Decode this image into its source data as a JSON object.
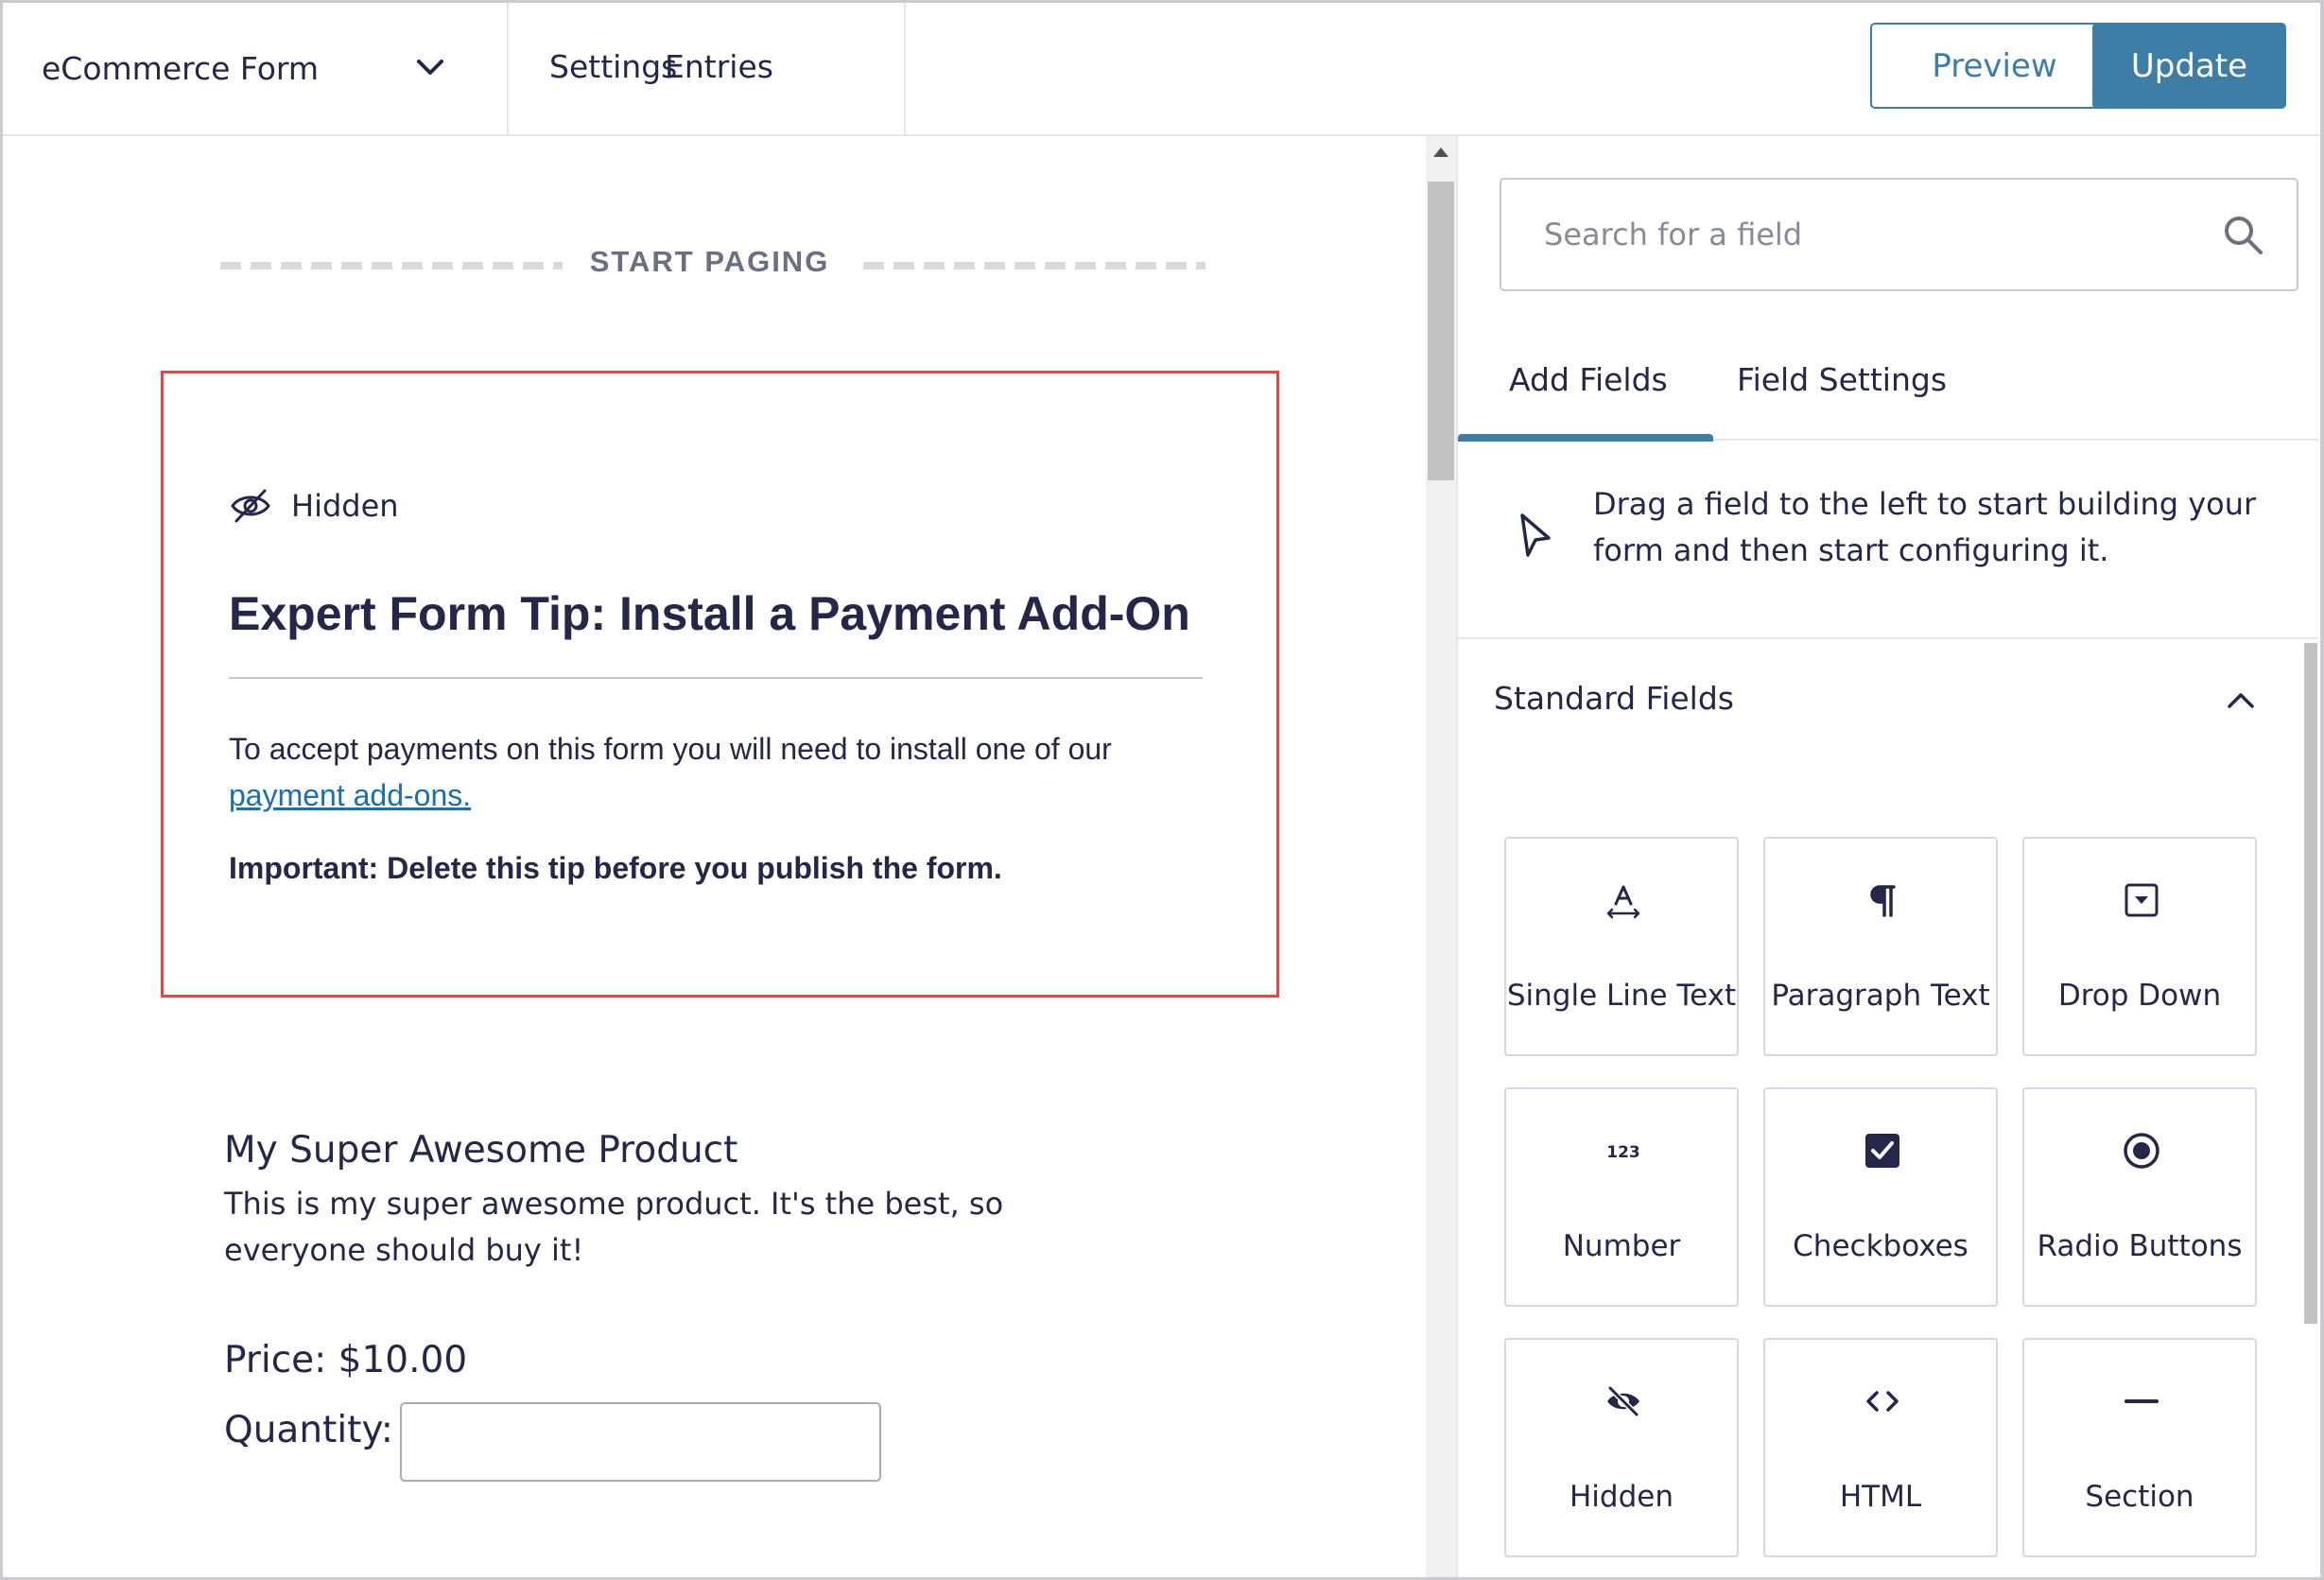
{
  "header": {
    "form_name": "eCommerce Form",
    "nav": [
      "Settings",
      "Entries"
    ],
    "preview_label": "Preview",
    "update_label": "Update"
  },
  "canvas": {
    "paging_label": "START PAGING",
    "tip": {
      "visibility": "Hidden",
      "title": "Expert Form Tip: Install a Payment Add-On",
      "body": "To accept payments on this form you will need to install one of our",
      "link": "payment add-ons.",
      "important": "Important: Delete this tip before you publish the form."
    },
    "product": {
      "title": "My Super Awesome Product",
      "description": "This is my super awesome product. It's the best, so everyone should buy it!",
      "price": "Price: $10.00",
      "quantity_label": "Quantity:"
    }
  },
  "sidebar": {
    "search_placeholder": "Search for a field",
    "tabs": [
      "Add Fields",
      "Field Settings"
    ],
    "hint": "Drag a field to the left to start building your form and then start configuring it.",
    "section_title": "Standard Fields",
    "fields": [
      {
        "label": "Single Line Text",
        "icon": "single-line-text-icon"
      },
      {
        "label": "Paragraph Text",
        "icon": "paragraph-icon"
      },
      {
        "label": "Drop Down",
        "icon": "dropdown-icon"
      },
      {
        "label": "Number",
        "icon": "number-icon"
      },
      {
        "label": "Checkboxes",
        "icon": "checkbox-icon"
      },
      {
        "label": "Radio Buttons",
        "icon": "radio-icon"
      },
      {
        "label": "Hidden",
        "icon": "hidden-icon"
      },
      {
        "label": "HTML",
        "icon": "code-icon"
      },
      {
        "label": "Section",
        "icon": "section-icon"
      }
    ]
  },
  "colors": {
    "accent": "#3e7da6",
    "text": "#242748",
    "highlight_border": "#e0484b",
    "link": "#1a6fb0"
  }
}
